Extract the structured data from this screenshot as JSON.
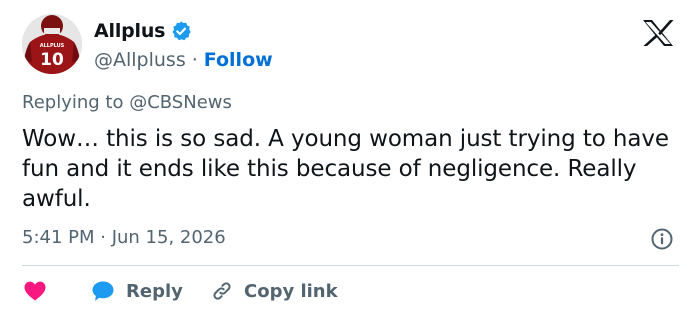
{
  "author": {
    "display_name": "Allplus",
    "handle": "@Allpluss",
    "separator": "·",
    "follow_label": "Follow",
    "avatar_jersey_text": "ALLPLUS",
    "avatar_jersey_number": "10"
  },
  "tweet": {
    "replying_to": "Replying to @CBSNews",
    "text": "Wow… this is so sad. A young woman just trying to have fun and it ends like this because of negligence. Really awful.",
    "timestamp": "5:41 PM · Jun 15, 2026"
  },
  "actions": {
    "reply_label": "Reply",
    "copy_link_label": "Copy link"
  },
  "icons": {
    "verified": "verified-badge-icon",
    "logo": "x-logo-icon",
    "info": "info-icon",
    "heart": "heart-icon",
    "reply": "reply-bubble-icon",
    "link": "link-icon"
  },
  "colors": {
    "text_primary": "#0f1419",
    "text_secondary": "#536471",
    "link_blue": "#006fd6",
    "verified_blue": "#1d9bf0",
    "heart_pink": "#f91880",
    "divider": "#cfd9de"
  }
}
